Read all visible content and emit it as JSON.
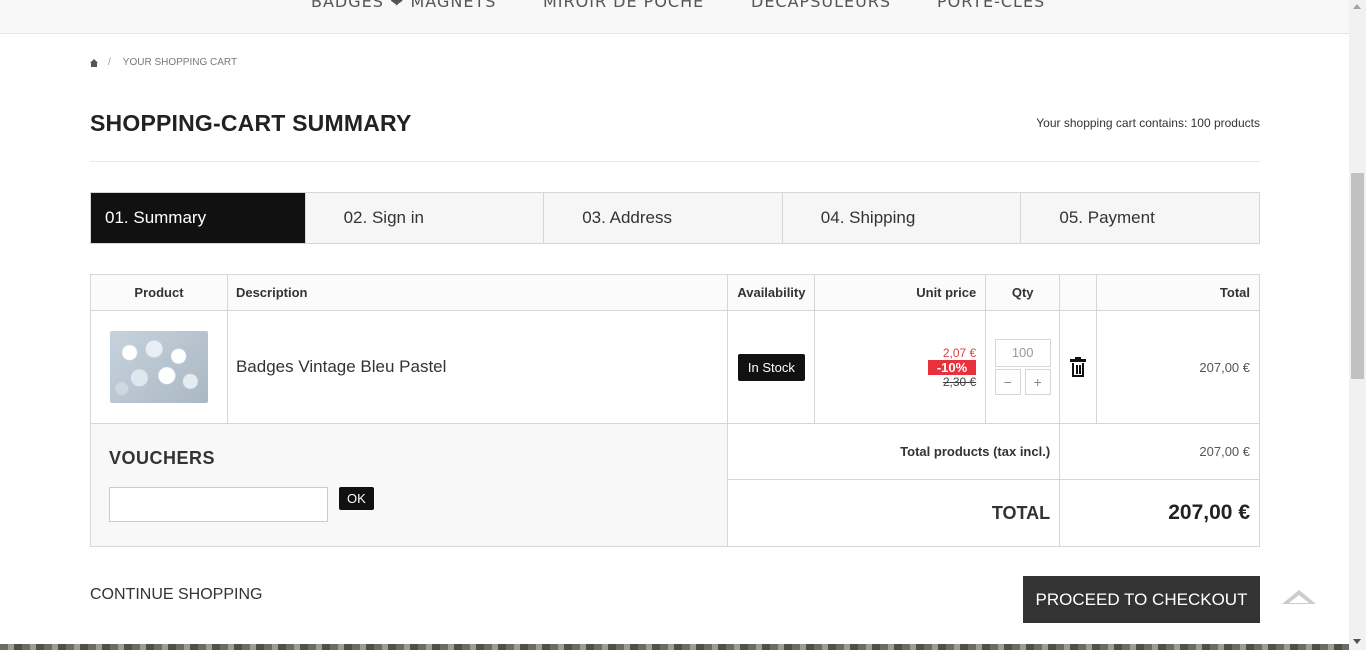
{
  "top_nav": {
    "items": [
      "BADGES ❤ MAGNETS",
      "MIROIR DE POCHE",
      "DÉCAPSULEURS",
      "PORTE-CLÉS"
    ]
  },
  "breadcrumb": {
    "separator": "/",
    "current": "YOUR SHOPPING CART"
  },
  "page": {
    "title": "SHOPPING-CART SUMMARY",
    "cart_count": "Your shopping cart contains: 100 products"
  },
  "steps": [
    {
      "label": "01. Summary",
      "active": true
    },
    {
      "label": "02. Sign in",
      "active": false
    },
    {
      "label": "03. Address",
      "active": false
    },
    {
      "label": "04. Shipping",
      "active": false
    },
    {
      "label": "05. Payment",
      "active": false
    }
  ],
  "table": {
    "headers": {
      "product": "Product",
      "description": "Description",
      "availability": "Availability",
      "unit_price": "Unit price",
      "qty": "Qty",
      "delete": "",
      "total": "Total"
    },
    "rows": [
      {
        "description": "Badges Vintage Bleu Pastel",
        "availability": "In Stock",
        "price_new": "2,07 €",
        "discount": "-10%",
        "price_old": "2,30 €",
        "qty": "100",
        "qty_minus": "−",
        "qty_plus": "+",
        "total": "207,00 €"
      }
    ]
  },
  "vouchers": {
    "title": "VOUCHERS",
    "input_value": "",
    "ok_label": "OK"
  },
  "summary": {
    "products_label": "Total products (tax incl.)",
    "products_value": "207,00 €",
    "total_label": "TOTAL",
    "total_value": "207,00 €"
  },
  "actions": {
    "continue_label": "CONTINUE SHOPPING",
    "checkout_label": "PROCEED TO CHECKOUT"
  },
  "colors": {
    "accent_dark": "#111111",
    "discount_red": "#e8313c",
    "price_red": "#e04040"
  }
}
